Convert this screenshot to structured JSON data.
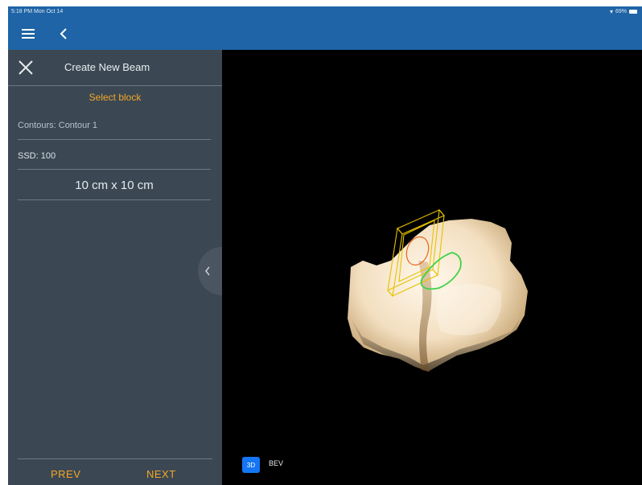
{
  "status": {
    "time": "5:18 PM",
    "date": "Mon Oct 14",
    "battery": "69%"
  },
  "nav": {
    "menu_icon": "hamburger-icon",
    "back_icon": "chevron-left-icon"
  },
  "sidebar": {
    "title": "Create New Beam",
    "select_block": "Select block",
    "contours": "Contours: Contour 1",
    "ssd": "SSD: 100",
    "field_size": "10 cm x 10 cm",
    "prev_label": "PREV",
    "next_label": "NEXT"
  },
  "viewport": {
    "mode_3d": "3D",
    "mode_bev": "BEV",
    "selected_mode": "3D"
  },
  "colors": {
    "nav_bar": "#1e64a6",
    "sidebar_bg": "#3b4854",
    "accent_orange": "#f5a623",
    "active_blue": "#1476f5",
    "block_outline": "#e6c200",
    "contour_green": "#3fd24a"
  }
}
